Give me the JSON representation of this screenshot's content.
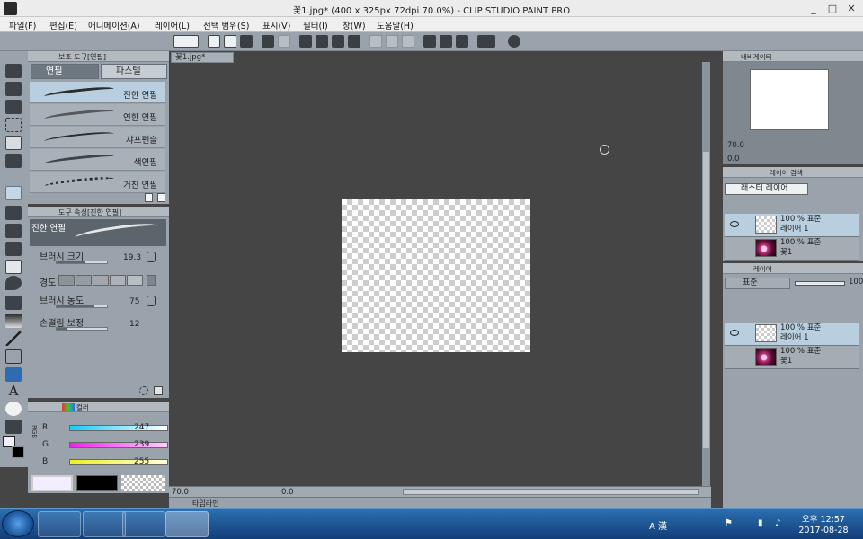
{
  "window": {
    "title": "꽃1.jpg* (400 x 325px 72dpi 70.0%)  - CLIP STUDIO PAINT PRO",
    "min": "_",
    "max": "□",
    "close": "✕"
  },
  "menu": [
    "파일(F)",
    "편집(E)",
    "애니메이션(A)",
    "레이어(L)",
    "선택 범위(S)",
    "표시(V)",
    "필터(I)",
    "창(W)",
    "도움말(H)"
  ],
  "canvas": {
    "tab_label": "꽃1.jpg*",
    "zoom": "70.0",
    "angle": "0.0",
    "timeline_label": "타임라인"
  },
  "subtool": {
    "title": "보조 도구[연필]",
    "tabs": [
      "연필",
      "파스텔"
    ],
    "brushes": [
      "진한 연필",
      "연한 연필",
      "샤프펜슬",
      "색연필",
      "거친 연필"
    ]
  },
  "tool_property": {
    "title": "도구 속성[진한 연필]",
    "preview_label": "진한 연필",
    "brush_size_label": "브러시 크기",
    "brush_size_value": "19.3",
    "brush_size_level": 0.55,
    "hardness_label": "경도",
    "density_label": "브러시 농도",
    "density_value": "75",
    "density_level": 0.75,
    "stabilization_label": "손떨림 보정",
    "stabilization_value": "12",
    "stabilization_level": 0.2
  },
  "color": {
    "tab_label": "컬러",
    "mode_label": "RGB",
    "rows": [
      {
        "label": "R",
        "value": "247"
      },
      {
        "label": "G",
        "value": "239"
      },
      {
        "label": "B",
        "value": "255"
      }
    ]
  },
  "navigator": {
    "tab_label": "내비게이터",
    "zoom": "70.0",
    "angle": "0.0"
  },
  "layer_search": {
    "tab_label": "레이어 검색",
    "filter": "래스터 레이어"
  },
  "layer": {
    "tab_label": "레이어",
    "blend_mode": "표준",
    "opacity": "100",
    "rows": [
      {
        "line1": "100 % 표준",
        "line2": "레이어 1"
      },
      {
        "line1": "100 % 표준",
        "line2": "꽃1"
      }
    ]
  },
  "taskbar": {
    "ime": "A 漢",
    "time": "오후 12:57",
    "date": "2017-08-28"
  }
}
